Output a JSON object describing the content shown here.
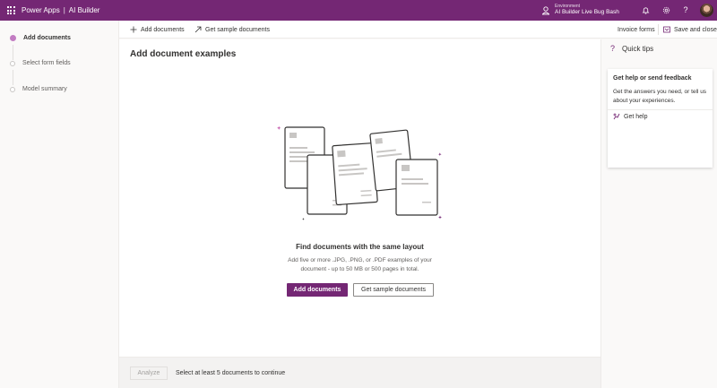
{
  "header": {
    "app_name": "Power Apps",
    "separator": "|",
    "product": "AI Builder",
    "environment_label": "Environment",
    "environment_name": "AI Builder Live Bug Bash",
    "icons": [
      "waffle-icon",
      "environment-icon",
      "bell-icon",
      "gear-icon",
      "help-icon",
      "avatar"
    ]
  },
  "steps": [
    {
      "label": "Add documents",
      "active": true
    },
    {
      "label": "Select form fields",
      "active": false
    },
    {
      "label": "Model summary",
      "active": false
    }
  ],
  "commandbar": {
    "add_documents": "Add documents",
    "get_sample_documents": "Get sample documents",
    "model_type": "Invoice forms",
    "save_and_close": "Save and close"
  },
  "main": {
    "title": "Add document examples",
    "empty_title": "Find documents with the same layout",
    "empty_description": "Add five or more .JPG, .PNG, or .PDF examples of your document - up to 50 MB or 500 pages in total.",
    "primary_button": "Add documents",
    "secondary_button": "Get sample documents"
  },
  "footer": {
    "analyze_button": "Analyze",
    "message": "Select at least 5 documents to continue"
  },
  "quick_tips": {
    "title": "Quick tips",
    "card_title": "Get help or send feedback",
    "card_body": "Get the answers you need, or tell us about your experiences.",
    "link": "Get help"
  },
  "colors": {
    "brand": "#742774",
    "step_active": "#c27cc2",
    "accent_pink": "#c24fa8"
  }
}
